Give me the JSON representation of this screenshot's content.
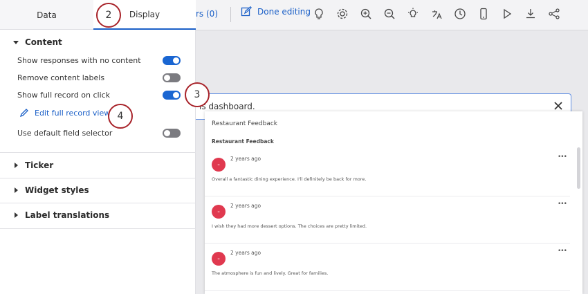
{
  "panel": {
    "tabs": [
      {
        "label": "Data"
      },
      {
        "label": "Display"
      }
    ],
    "sections": {
      "content": {
        "title": "Content",
        "options": [
          {
            "label": "Show responses with no content",
            "enabled": true
          },
          {
            "label": "Remove content labels",
            "enabled": false
          },
          {
            "label": "Show full record on click",
            "enabled": true
          }
        ],
        "edit_link": "Edit full record view",
        "default_field_selector": {
          "label": "Use default field selector",
          "enabled": false
        }
      },
      "ticker": {
        "title": "Ticker"
      },
      "widget_styles": {
        "title": "Widget styles"
      },
      "label_translations": {
        "title": "Label translations"
      }
    }
  },
  "callouts": [
    "2",
    "3",
    "4"
  ],
  "toolbar": {
    "filters_label": "rs (0)",
    "done_label": "Done editing",
    "icons": [
      "lightbulb-question-icon",
      "gear-icon",
      "zoom-in-icon",
      "zoom-out-icon",
      "idea-icon",
      "translate-icon",
      "clock-icon",
      "mobile-icon",
      "play-icon",
      "download-icon",
      "share-icon"
    ]
  },
  "banner": {
    "text": "is dashboard."
  },
  "feed": {
    "title": "Restaurant Feedback",
    "subtitle": "Restaurant Feedback",
    "responses": [
      {
        "avatar": "-",
        "time": "2 years ago",
        "text": "Overall a fantastic dining experience. I'll definitely be back for more."
      },
      {
        "avatar": "-",
        "time": "2 years ago",
        "text": "I wish they had more dessert options. The choices are pretty limited."
      },
      {
        "avatar": "-",
        "time": "2 years ago",
        "text": "The atmosphere is fun and lively. Great for families."
      }
    ],
    "more_label": "•••"
  },
  "colors": {
    "accent": "#1a5fc7",
    "toggle_on": "#1a66d2",
    "toggle_off": "#7b7b80",
    "badge_border": "#a8232a",
    "avatar": "#e0394f"
  }
}
